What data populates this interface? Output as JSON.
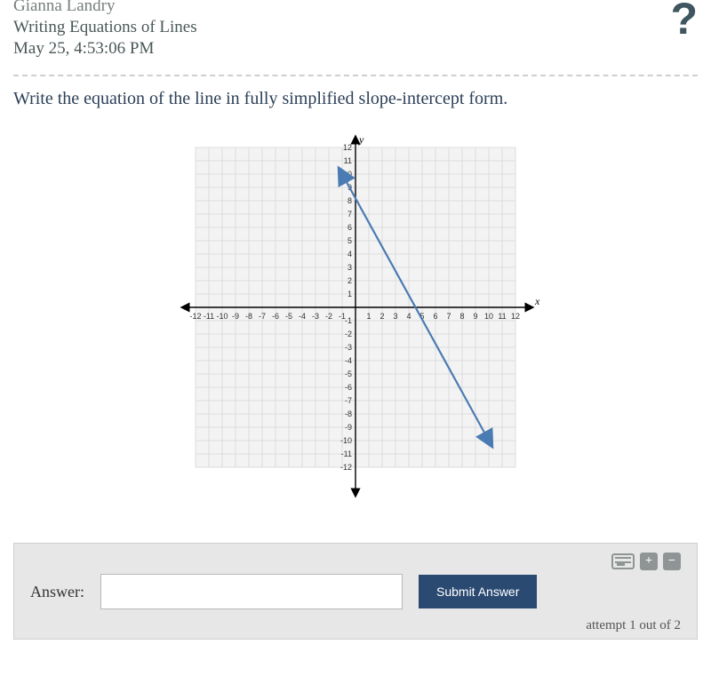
{
  "header": {
    "student_name": "Gianna Landry",
    "assignment_title": "Writing Equations of Lines",
    "timestamp": "May 25, 4:53:06 PM"
  },
  "question": {
    "prompt": "Write the equation of the line in fully simplified slope-intercept form."
  },
  "chart_data": {
    "type": "line",
    "title": "",
    "xlabel": "x",
    "ylabel": "y",
    "xlim": [
      -12,
      12
    ],
    "ylim": [
      -12,
      12
    ],
    "x_ticks": [
      -12,
      -11,
      -10,
      -9,
      -8,
      -7,
      -6,
      -5,
      -4,
      -3,
      -2,
      -1,
      1,
      2,
      3,
      4,
      5,
      6,
      7,
      8,
      9,
      10,
      11,
      12
    ],
    "y_ticks": [
      -12,
      -11,
      -10,
      -9,
      -8,
      -7,
      -6,
      -5,
      -4,
      -3,
      -2,
      -1,
      1,
      2,
      3,
      4,
      5,
      6,
      7,
      8,
      9,
      10,
      11,
      12
    ],
    "grid": true,
    "series": [
      {
        "name": "line",
        "color": "#4b7bb3",
        "points": [
          {
            "x": -1,
            "y": 10
          },
          {
            "x": 10,
            "y": -10
          }
        ],
        "slope": -1.818,
        "y_intercept": 8.18,
        "arrows": "both"
      }
    ]
  },
  "answer": {
    "label": "Answer:",
    "value": "",
    "placeholder": "",
    "submit_label": "Submit Answer",
    "attempt_text": "attempt 1 out of 2"
  },
  "tools": {
    "plus": "+",
    "minus": "−"
  }
}
